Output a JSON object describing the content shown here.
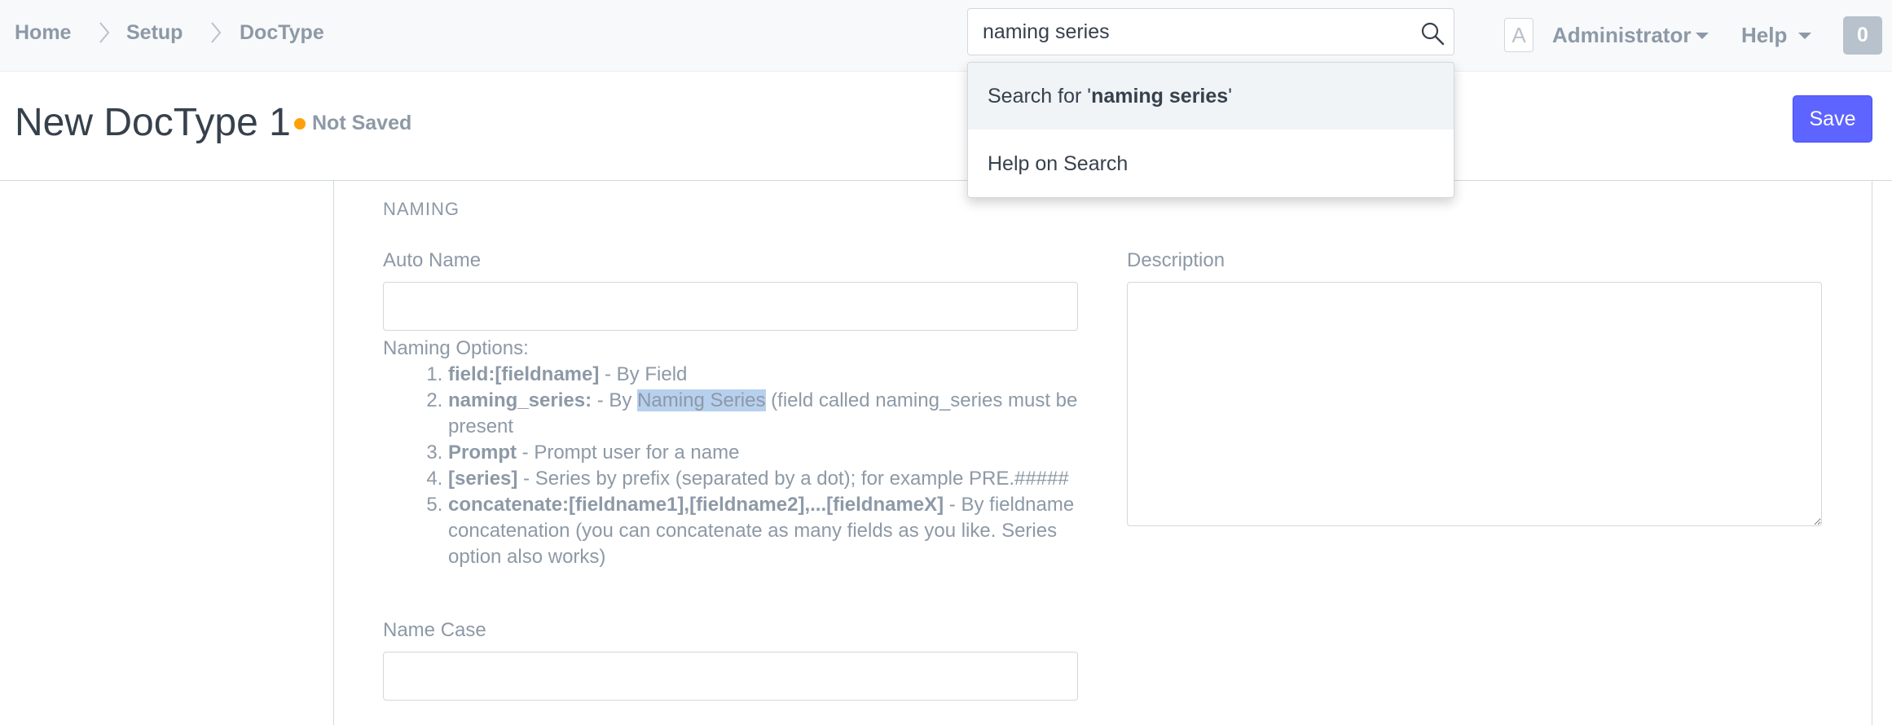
{
  "breadcrumb": [
    "Home",
    "Setup",
    "DocType"
  ],
  "search": {
    "value": "naming series",
    "icon": "search-icon"
  },
  "user": {
    "avatar_letter": "A",
    "name": "Administrator"
  },
  "help_label": "Help",
  "notifications_count": "0",
  "dropdown": {
    "search_prefix": "Search for '",
    "search_term": "naming series",
    "search_suffix": "'",
    "help_item": "Help on Search"
  },
  "page": {
    "title": "New DocType 1",
    "status": "Not Saved",
    "save_label": "Save"
  },
  "colors": {
    "primary": "#5e64ff",
    "status_dot": "#ffa00a",
    "muted_text": "#8d99a6",
    "highlight": "#b7d0ee"
  },
  "form": {
    "section": "NAMING",
    "auto_name_label": "Auto Name",
    "description_label": "Description",
    "naming_options_title": "Naming Options:",
    "options": {
      "o1_bold": "field:[fieldname]",
      "o1_text": " - By Field",
      "o2_bold": "naming_series:",
      "o2_pre": " - By ",
      "o2_hl": "Naming Series",
      "o2_post": " (field called naming_series must be present",
      "o3_bold": "Prompt",
      "o3_text": " - Prompt user for a name",
      "o4_bold": "[series]",
      "o4_text": " - Series by prefix (separated by a dot); for example PRE.#####",
      "o5_bold": "concatenate:[fieldname1],[fieldname2],...[fieldnameX]",
      "o5_text": " - By fieldname concatenation (you can concatenate as many fields as you like. Series option also works)"
    },
    "name_case_label": "Name Case"
  }
}
